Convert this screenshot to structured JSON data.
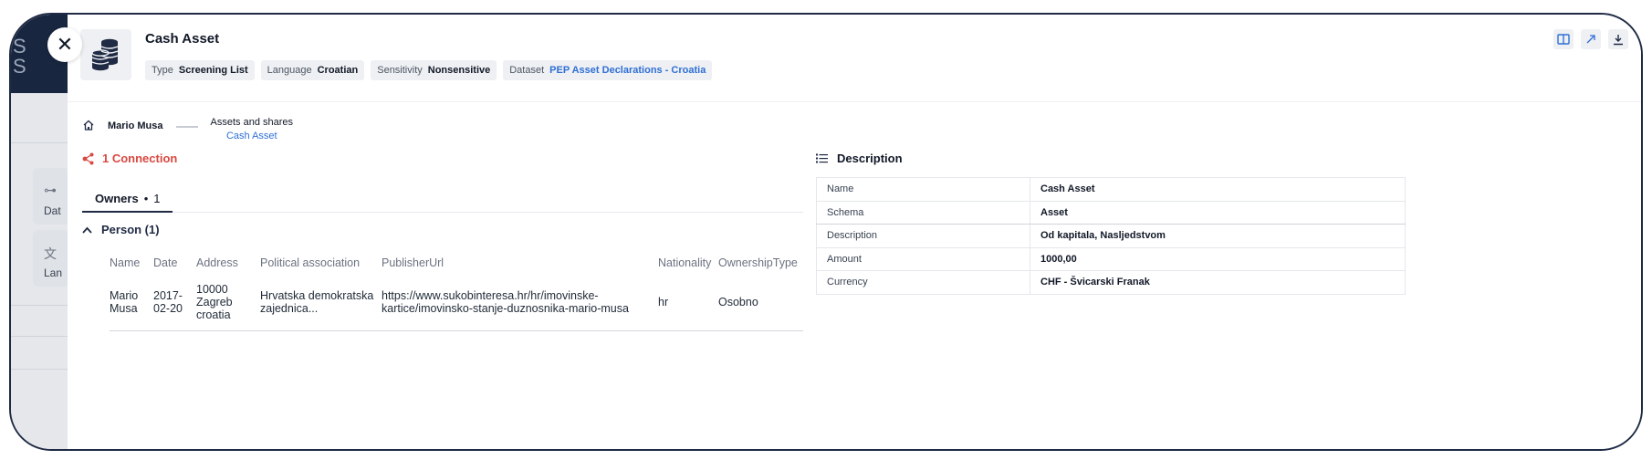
{
  "header": {
    "title": "Cash Asset",
    "tags": [
      {
        "key": "Type",
        "value": "Screening List"
      },
      {
        "key": "Language",
        "value": "Croatian"
      },
      {
        "key": "Sensitivity",
        "value": "Nonsensitive"
      },
      {
        "key": "Dataset",
        "value": "PEP Asset Declarations - Croatia"
      }
    ],
    "actions": [
      "book-open-icon",
      "external-link-icon",
      "download-icon"
    ]
  },
  "background": {
    "dark_letters": "S\nS",
    "card1_label": "Dat",
    "card2_label": "Lan"
  },
  "breadcrumb": {
    "person": "Mario Musa",
    "group": "Assets and shares",
    "current": "Cash Asset"
  },
  "connections": {
    "label": "1 Connection"
  },
  "tabs": [
    {
      "label": "Owners",
      "count": "1"
    }
  ],
  "group": {
    "label": "Person (1)"
  },
  "table": {
    "columns": [
      "Name",
      "Date",
      "Address",
      "Political association",
      "PublisherUrl",
      "Nationality",
      "OwnershipType"
    ],
    "rows": [
      [
        "Mario\nMusa",
        "2017-\n02-20",
        "10000\nZagreb\ncroatia",
        "Hrvatska demokratska\nzajednica...",
        "https://www.sukobinteresa.hr/hr/imovinske-\nkartice/imovinsko-stanje-duznosnika-mario-musa",
        "hr",
        "Osobno"
      ]
    ]
  },
  "description": {
    "title": "Description",
    "rows": [
      {
        "key": "Name",
        "value": "Cash Asset"
      },
      {
        "key": "Schema",
        "value": "Asset"
      },
      {
        "key": "Description",
        "value": "Od kapitala, Nasljedstvom"
      },
      {
        "key": "Amount",
        "value": "1000,00"
      },
      {
        "key": "Currency",
        "value": "CHF - Švicarski Franak"
      }
    ]
  },
  "colors": {
    "accent_link": "#2f6fd6",
    "connection_red": "#d94841",
    "frame": "#1f2a44"
  }
}
